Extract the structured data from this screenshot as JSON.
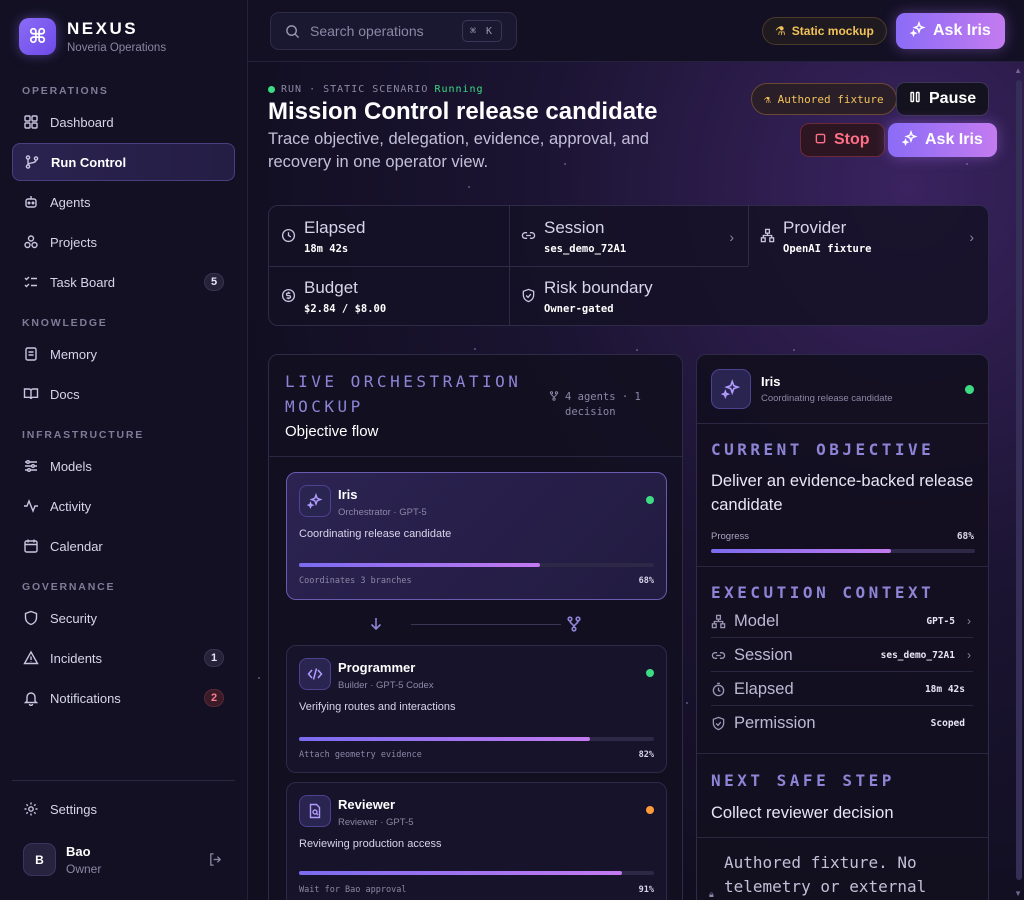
{
  "brand": {
    "name": "NEXUS",
    "subtitle": "Noveria Operations"
  },
  "sidebar": {
    "sections": [
      "OPERATIONS",
      "KNOWLEDGE",
      "INFRASTRUCTURE",
      "GOVERNANCE"
    ],
    "items": [
      {
        "label": "Dashboard",
        "icon": "dashboard-icon"
      },
      {
        "label": "Run Control",
        "icon": "branch-icon",
        "active": true
      },
      {
        "label": "Agents",
        "icon": "robot-icon"
      },
      {
        "label": "Projects",
        "icon": "cubes-icon"
      },
      {
        "label": "Task Board",
        "icon": "checklist-icon",
        "badge": "5"
      },
      {
        "label": "Memory",
        "icon": "document-icon"
      },
      {
        "label": "Docs",
        "icon": "book-icon"
      },
      {
        "label": "Models",
        "icon": "sliders-icon"
      },
      {
        "label": "Activity",
        "icon": "pulse-icon"
      },
      {
        "label": "Calendar",
        "icon": "calendar-icon"
      },
      {
        "label": "Security",
        "icon": "shield-icon"
      },
      {
        "label": "Incidents",
        "icon": "warning-icon",
        "badge": "1"
      },
      {
        "label": "Notifications",
        "icon": "bell-icon",
        "badge": "2"
      }
    ],
    "settings_label": "Settings",
    "user": {
      "initial": "B",
      "name": "Bao",
      "role": "Owner"
    }
  },
  "topbar": {
    "search_placeholder": "Search operations",
    "shortcut": "⌘ K",
    "static_label": "Static mockup",
    "ask_label": "Ask Iris"
  },
  "header": {
    "run_label": "RUN · STATIC SCENARIO",
    "status": "Running",
    "title": "Mission Control release candidate",
    "description": "Trace objective, delegation, evidence, approval, and recovery in one operator view.",
    "fixture_label": "Authored fixture",
    "pause_label": "Pause",
    "stop_label": "Stop",
    "ask_label": "Ask Iris"
  },
  "stats": {
    "elapsed": {
      "label": "Elapsed",
      "value": "18m 42s"
    },
    "session": {
      "label": "Session",
      "value": "ses_demo_72A1"
    },
    "provider": {
      "label": "Provider",
      "value": "OpenAI fixture"
    },
    "budget": {
      "label": "Budget",
      "value": "$2.84 / $8.00"
    },
    "risk": {
      "label": "Risk boundary",
      "value": "Owner-gated"
    }
  },
  "orchestration": {
    "eyebrow": "LIVE ORCHESTRATION MOCKUP",
    "title": "Objective flow",
    "meta": "4 agents · 1 decision",
    "agents": [
      {
        "name": "Iris",
        "role": "Orchestrator · GPT-5",
        "task": "Coordinating release candidate",
        "foot": "Coordinates 3 branches",
        "pct": "68%",
        "progress": 0.68,
        "status_color": "#3ddc84"
      },
      {
        "name": "Programmer",
        "role": "Builder · GPT-5 Codex",
        "task": "Verifying routes and interactions",
        "foot": "Attach geometry evidence",
        "pct": "82%",
        "progress": 0.82,
        "status_color": "#3ddc84"
      },
      {
        "name": "Reviewer",
        "role": "Reviewer · GPT-5",
        "task": "Reviewing production access",
        "foot": "Wait for Bao approval",
        "pct": "91%",
        "progress": 0.91,
        "status_color": "#ff9a3c"
      }
    ]
  },
  "iris": {
    "name": "Iris",
    "subtitle": "Coordinating release candidate",
    "objective_eyebrow": "CURRENT OBJECTIVE",
    "objective": "Deliver an evidence-backed release candidate",
    "progress_label": "Progress",
    "progress_pct": "68%",
    "progress": 0.68,
    "context_eyebrow": "EXECUTION CONTEXT",
    "context": [
      {
        "label": "Model",
        "value": "GPT-5"
      },
      {
        "label": "Session",
        "value": "ses_demo_72A1"
      },
      {
        "label": "Elapsed",
        "value": "18m 42s"
      },
      {
        "label": "Permission",
        "value": "Scoped"
      }
    ],
    "next_eyebrow": "NEXT SAFE STEP",
    "next": "Collect reviewer decision",
    "note": "Authored fixture. No telemetry or external"
  },
  "colors": {
    "accent": "#8b6cf6",
    "running": "#3ddc84",
    "warning": "#f2c25a",
    "danger": "#ff6f86"
  }
}
